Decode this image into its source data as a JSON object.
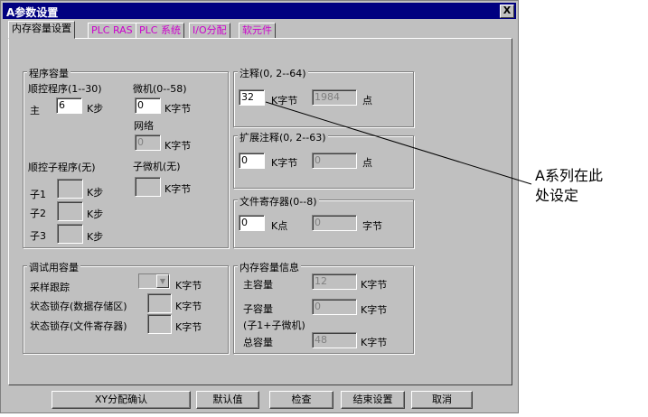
{
  "window": {
    "title": "A参数设置",
    "close_label": "X"
  },
  "tabs": [
    {
      "label": "内存容量设置"
    },
    {
      "label": "PLC RAS"
    },
    {
      "label": "PLC 系统"
    },
    {
      "label": "I/O分配"
    },
    {
      "label": "软元件"
    }
  ],
  "program_capacity": {
    "title": "程序容量",
    "sequence_label": "顺控程序(1--30)",
    "main_label": "主",
    "main_value": "6",
    "k_step": "K步",
    "micro_label": "微机(0--58)",
    "micro_value": "0",
    "k_byte": "K字节",
    "network_label": "网络",
    "network_value": "0",
    "sub_sequence_label": "顺控子程序(无)",
    "sub_micro_label": "子微机(无)",
    "sub1": "子1",
    "sub2": "子2",
    "sub3": "子3"
  },
  "comment": {
    "title": "注释(0, 2--64)",
    "value": "32",
    "unit": "K字节",
    "points": "1984",
    "points_unit": "点"
  },
  "ext_comment": {
    "title": "扩展注释(0, 2--63)",
    "value": "0",
    "unit": "K字节",
    "points": "0",
    "points_unit": "点"
  },
  "file_register": {
    "title": "文件寄存器(0--8)",
    "value": "0",
    "unit": "K点",
    "bytes": "0",
    "bytes_unit": "字节"
  },
  "debug_capacity": {
    "title": "调试用容量",
    "trace_label": "采样跟踪",
    "trace_unit": "K字节",
    "latch_data_label": "状态锁存(数据存储区)",
    "latch_data_unit": "K字节",
    "latch_file_label": "状态锁存(文件寄存器)",
    "latch_file_unit": "K字节"
  },
  "memory_info": {
    "title": "内存容量信息",
    "main_label": "主容量",
    "main_value": "12",
    "main_unit": "K字节",
    "sub_label": "子容量",
    "sub_value": "0",
    "sub_unit": "K字节",
    "sub_note": "(子1+子微机)",
    "total_label": "总容量",
    "total_value": "48",
    "total_unit": "K字节"
  },
  "buttons": {
    "xy_confirm": "XY分配确认",
    "default": "默认值",
    "check": "检查",
    "end_setting": "结束设置",
    "cancel": "取消"
  },
  "annotation": {
    "line1": "A系列在此",
    "line2": "处设定"
  }
}
